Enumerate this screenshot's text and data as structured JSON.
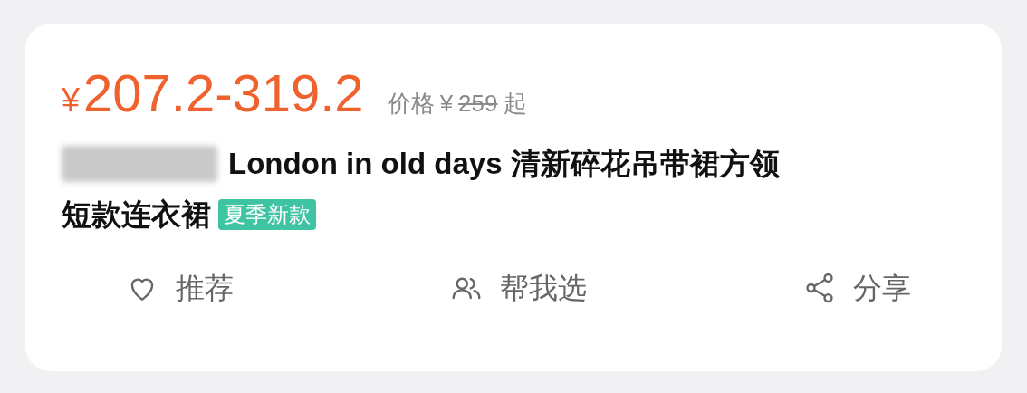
{
  "price": {
    "currency": "¥",
    "amount": "207.2-319.2"
  },
  "original_price": {
    "label": "价格",
    "currency": "¥",
    "amount": "259",
    "struck": true,
    "suffix": "起"
  },
  "title": {
    "redacted_prefix": true,
    "lines": [
      "London in old days 清新碎花吊带裙方领",
      "短款连衣裙"
    ],
    "tag": "夏季新款"
  },
  "actions": [
    {
      "kind": "heart",
      "label": "推荐"
    },
    {
      "kind": "people",
      "label": "帮我选"
    },
    {
      "kind": "share",
      "label": "分享"
    }
  ]
}
